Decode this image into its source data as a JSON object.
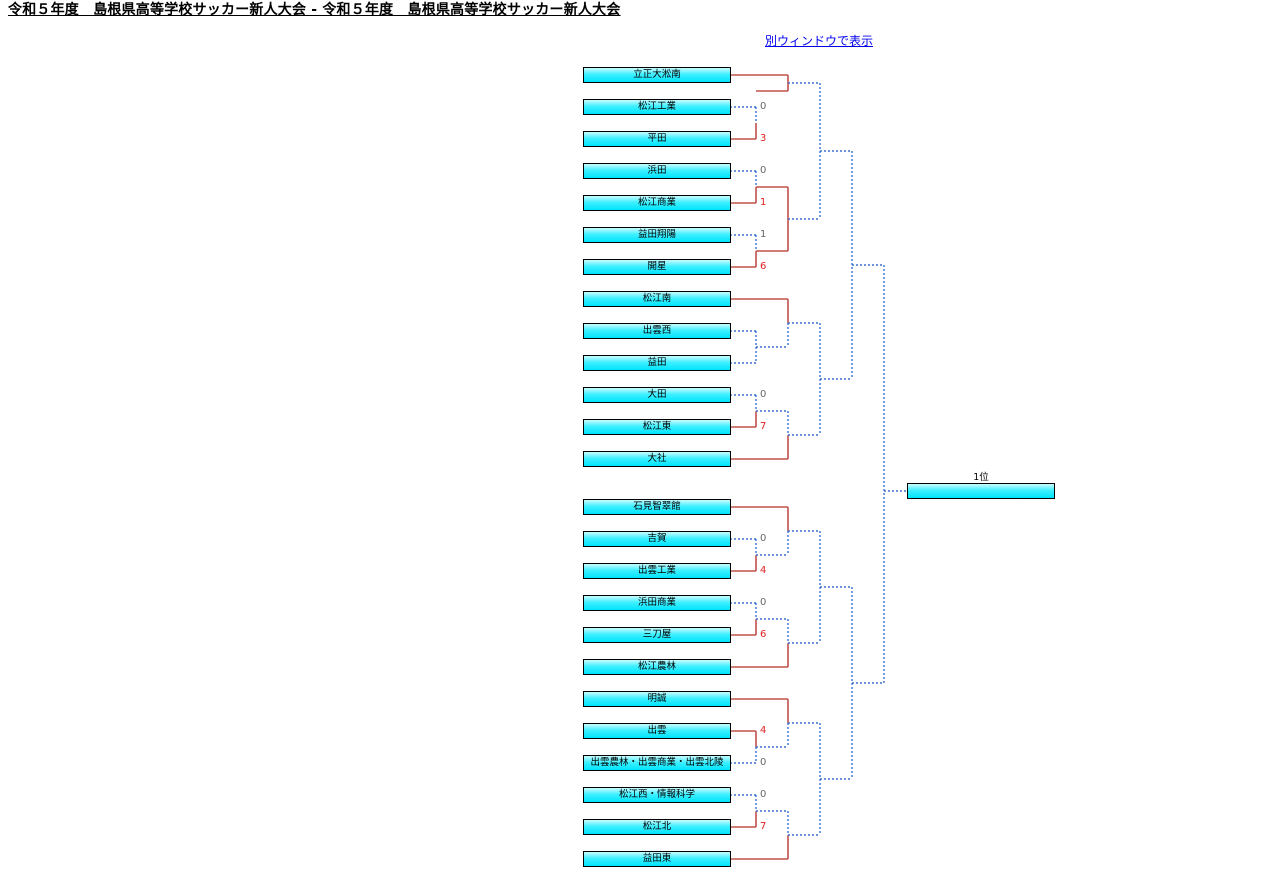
{
  "title": "令和５年度　島根県高等学校サッカー新人大会 - 令和５年度　島根県高等学校サッカー新人大会",
  "open_window_link": "別ウィンドウで表示",
  "winner_label": "1位",
  "winner_name": "",
  "colors": {
    "result_line": "#c0504d",
    "pending_line": "#3b6fd0",
    "win_score": "#e02020",
    "lose_score": "#666666",
    "team_box_gradient": [
      "#c8fcff",
      "#00e4ff"
    ]
  },
  "teams": [
    "立正大淞南",
    "松江工業",
    "平田",
    "浜田",
    "松江商業",
    "益田翔陽",
    "開星",
    "松江南",
    "出雲西",
    "益田",
    "大田",
    "松江東",
    "大社",
    "石見智翠館",
    "吉賀",
    "出雲工業",
    "浜田商業",
    "三刀屋",
    "松江農林",
    "明誠",
    "出雲",
    "出雲農林・出雲商業・出雲北陵",
    "松江西・情報科学",
    "松江北",
    "益田東"
  ],
  "first_round_matches": [
    {
      "a": 1,
      "b": 2,
      "score_a": "0",
      "score_b": "3",
      "winner": "b"
    },
    {
      "a": 3,
      "b": 4,
      "score_a": "0",
      "score_b": "1",
      "winner": "b"
    },
    {
      "a": 5,
      "b": 6,
      "score_a": "1",
      "score_b": "6",
      "winner": "b"
    },
    {
      "a": 8,
      "b": 9,
      "score_a": "",
      "score_b": "",
      "winner": ""
    },
    {
      "a": 10,
      "b": 11,
      "score_a": "0",
      "score_b": "7",
      "winner": "b"
    },
    {
      "a": 14,
      "b": 15,
      "score_a": "0",
      "score_b": "4",
      "winner": "b"
    },
    {
      "a": 16,
      "b": 17,
      "score_a": "0",
      "score_b": "6",
      "winner": "b"
    },
    {
      "a": 20,
      "b": 21,
      "score_a": "4",
      "score_b": "0",
      "winner": "a"
    },
    {
      "a": 22,
      "b": 23,
      "score_a": "0",
      "score_b": "7",
      "winner": "b"
    }
  ],
  "second_round_matches": [
    {
      "a": 0,
      "b": 0.5,
      "winner": "both"
    },
    {
      "a": 3.5,
      "b": 5.5,
      "winner": "both"
    },
    {
      "a": 7,
      "b": 8.5,
      "winner": "a"
    },
    {
      "a": 10.5,
      "b": 12,
      "winner": "b"
    },
    {
      "a": 13,
      "b": 14.5,
      "winner": "a"
    },
    {
      "a": 16.5,
      "b": 18,
      "winner": "b"
    },
    {
      "a": 19,
      "b": 20.5,
      "winner": "a"
    },
    {
      "a": 22.5,
      "b": 24,
      "winner": "b"
    }
  ]
}
